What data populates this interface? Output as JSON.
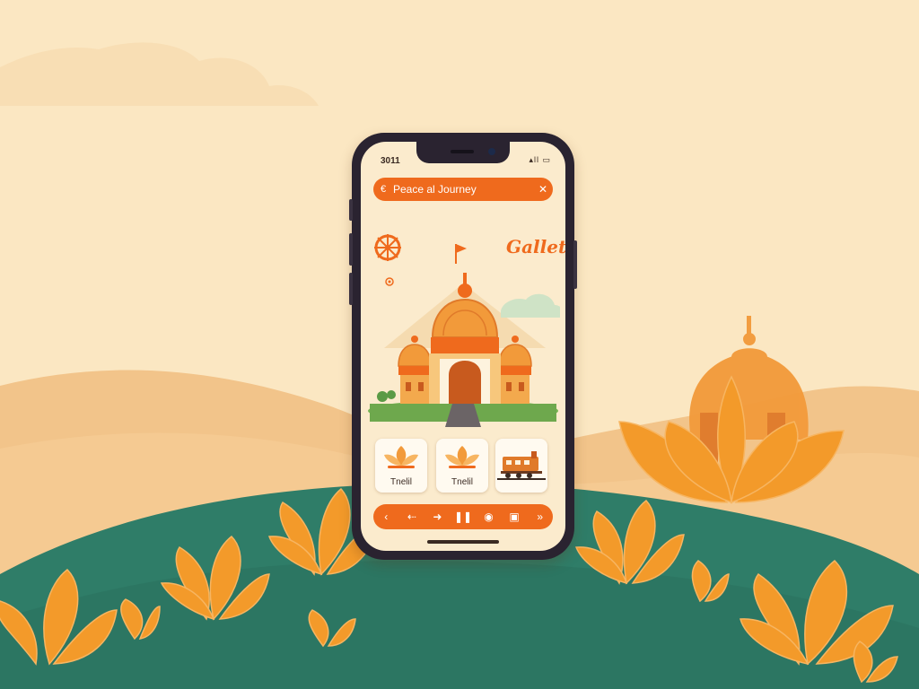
{
  "status": {
    "time": "3011",
    "icons": "▴ll ▭"
  },
  "header": {
    "back_icon": "back-icon",
    "back_label": "€",
    "title": "Peace al Journey",
    "close_label": "✕"
  },
  "brand": {
    "text": "Gallet"
  },
  "cards": [
    {
      "label": "Tnelil",
      "icon": "lotus-icon"
    },
    {
      "label": "Tnelil",
      "icon": "lotus-icon"
    },
    {
      "label": "",
      "icon": "train-icon"
    }
  ],
  "controls": {
    "prev": "‹",
    "rewind": "⇠",
    "forward": "➜",
    "pause": "❚❚",
    "record": "◉",
    "book": "▣",
    "next": "»"
  },
  "colors": {
    "accent": "#ef6a1d",
    "hill": "#2f7d68",
    "lotus": "#f39a2a",
    "sky": "#fbe7c2"
  }
}
